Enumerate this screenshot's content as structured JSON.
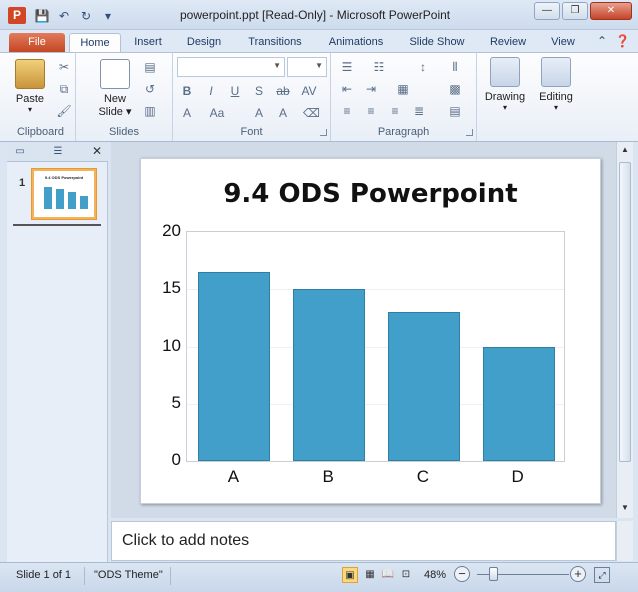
{
  "window": {
    "title": "powerpoint.ppt [Read-Only]  -  Microsoft PowerPoint",
    "app_icon_letter": "P",
    "minimize": "—",
    "restore": "❐",
    "close": "✕"
  },
  "tabs": [
    "File",
    "Home",
    "Insert",
    "Design",
    "Transitions",
    "Animations",
    "Slide Show",
    "Review",
    "View"
  ],
  "active_tab": "Home",
  "ribbon": {
    "clipboard": {
      "label": "Clipboard",
      "paste": "Paste"
    },
    "slides": {
      "label": "Slides",
      "new_slide_line1": "New",
      "new_slide_line2": "Slide"
    },
    "font": {
      "label": "Font",
      "font_name": "",
      "font_size": ""
    },
    "paragraph": {
      "label": "Paragraph"
    },
    "drawing": {
      "label": "Drawing"
    },
    "editing": {
      "label": "Editing"
    }
  },
  "slide_panel": {
    "slide_number": "1",
    "thumb_title": "9.4 ODS Powerpoint"
  },
  "notes": {
    "placeholder": "Click to add notes"
  },
  "status": {
    "slide_info": "Slide 1 of 1",
    "theme": "\"ODS Theme\"",
    "zoom": "48%"
  },
  "chart_data": {
    "type": "bar",
    "title": "9.4 ODS Powerpoint",
    "categories": [
      "A",
      "B",
      "C",
      "D"
    ],
    "values": [
      16.5,
      15,
      13,
      10
    ],
    "ylim": [
      0,
      20
    ],
    "yticks": [
      "0",
      "5",
      "10",
      "15",
      "20"
    ],
    "bar_color": "#419fca",
    "grid": true
  }
}
